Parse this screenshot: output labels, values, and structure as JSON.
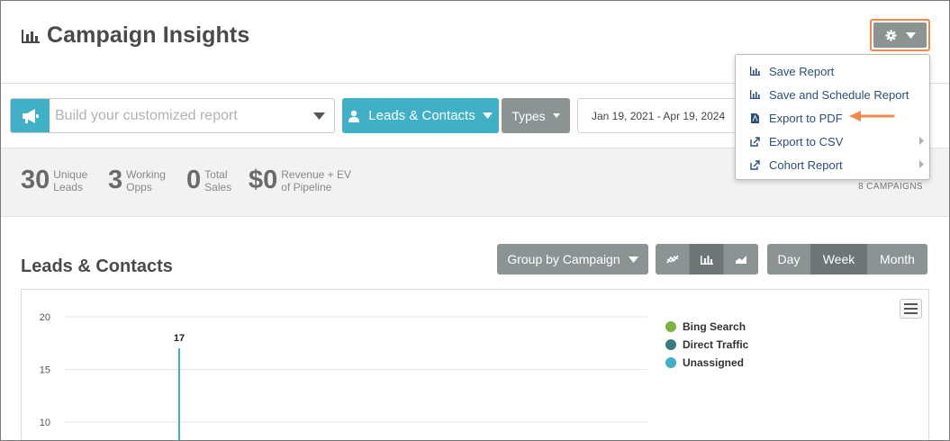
{
  "header": {
    "title": "Campaign Insights"
  },
  "toolbar": {
    "search_placeholder": "Build your customized report",
    "leads_label": "Leads & Contacts",
    "types_label": "Types",
    "date_range": "Jan 19, 2021 - Apr 19, 2024"
  },
  "stats": [
    {
      "value": "30",
      "label1": "Unique",
      "label2": "Leads"
    },
    {
      "value": "3",
      "label1": "Working",
      "label2": "Opps"
    },
    {
      "value": "0",
      "label1": "Total",
      "label2": "Sales"
    },
    {
      "value": "$0",
      "label1": "Revenue + EV",
      "label2": "of Pipeline"
    }
  ],
  "campaigns_count": "8 CAMPAIGNS",
  "section": {
    "title": "Leads & Contacts",
    "group_by_label": "Group by Campaign",
    "periods": [
      "Day",
      "Week",
      "Month"
    ],
    "active_period": "Week"
  },
  "menu": {
    "items": [
      {
        "label": "Save Report",
        "icon": "bar-chart-icon",
        "submenu": false
      },
      {
        "label": "Save and Schedule Report",
        "icon": "bar-chart-icon",
        "submenu": false
      },
      {
        "label": "Export to PDF",
        "icon": "pdf-file-icon",
        "submenu": false
      },
      {
        "label": "Export to CSV",
        "icon": "external-link-icon",
        "submenu": true
      },
      {
        "label": "Cohort Report",
        "icon": "external-link-icon",
        "submenu": true
      }
    ]
  },
  "colors": {
    "accent": "#3fb0c6",
    "gray_button": "#8c9493",
    "highlight": "#f08a4b",
    "bing_search": "#7cb342",
    "direct_traffic": "#3a7a82",
    "unassigned": "#3fb0c6"
  },
  "chart_data": {
    "type": "bar",
    "y_ticks": [
      "20",
      "15",
      "10"
    ],
    "ylim": [
      0,
      20
    ],
    "series": [
      {
        "name": "Bing Search",
        "color": "#7cb342"
      },
      {
        "name": "Direct Traffic",
        "color": "#3a7a82"
      },
      {
        "name": "Unassigned",
        "color": "#3fb0c6"
      }
    ],
    "visible_bars": [
      {
        "series": "Unassigned",
        "value": 17,
        "label": "17"
      }
    ]
  }
}
